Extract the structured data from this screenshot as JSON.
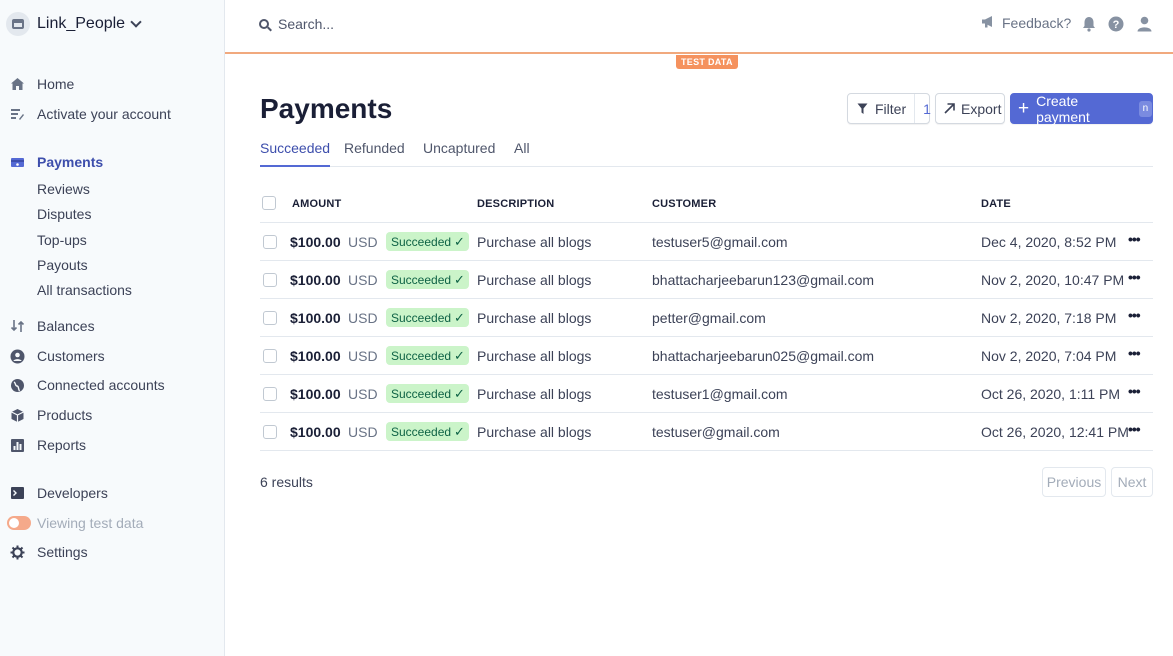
{
  "account": {
    "name": "Link_People"
  },
  "search": {
    "placeholder": "Search..."
  },
  "topbar": {
    "feedback": "Feedback?"
  },
  "test_data_badge": "TEST DATA",
  "nav": {
    "home": "Home",
    "activate": "Activate your account",
    "payments": "Payments",
    "payments_sub": [
      "Reviews",
      "Disputes",
      "Top-ups",
      "Payouts",
      "All transactions"
    ],
    "balances": "Balances",
    "customers": "Customers",
    "connected": "Connected accounts",
    "products": "Products",
    "reports": "Reports",
    "developers": "Developers",
    "viewing_test": "Viewing test data",
    "settings": "Settings"
  },
  "page": {
    "title": "Payments",
    "filter_label": "Filter",
    "filter_count": "1",
    "export_label": "Export",
    "create_label": "Create payment",
    "create_shortcut": "n",
    "tabs": [
      "Succeeded",
      "Refunded",
      "Uncaptured",
      "All"
    ]
  },
  "table": {
    "headers": {
      "amount": "AMOUNT",
      "description": "DESCRIPTION",
      "customer": "CUSTOMER",
      "date": "DATE"
    },
    "rows": [
      {
        "amount": "$100.00",
        "currency": "USD",
        "status": "Succeeded",
        "description": "Purchase all blogs",
        "customer": "testuser5@gmail.com",
        "date": "Dec 4, 2020, 8:52 PM"
      },
      {
        "amount": "$100.00",
        "currency": "USD",
        "status": "Succeeded",
        "description": "Purchase all blogs",
        "customer": "bhattacharjeebarun123@gmail.com",
        "date": "Nov 2, 2020, 10:47 PM"
      },
      {
        "amount": "$100.00",
        "currency": "USD",
        "status": "Succeeded",
        "description": "Purchase all blogs",
        "customer": "petter@gmail.com",
        "date": "Nov 2, 2020, 7:18 PM"
      },
      {
        "amount": "$100.00",
        "currency": "USD",
        "status": "Succeeded",
        "description": "Purchase all blogs",
        "customer": "bhattacharjeebarun025@gmail.com",
        "date": "Nov 2, 2020, 7:04 PM"
      },
      {
        "amount": "$100.00",
        "currency": "USD",
        "status": "Succeeded",
        "description": "Purchase all blogs",
        "customer": "testuser1@gmail.com",
        "date": "Oct 26, 2020, 1:11 PM"
      },
      {
        "amount": "$100.00",
        "currency": "USD",
        "status": "Succeeded",
        "description": "Purchase all blogs",
        "customer": "testuser@gmail.com",
        "date": "Oct 26, 2020, 12:41 PM"
      }
    ]
  },
  "footer": {
    "results": "6 results",
    "previous": "Previous",
    "next": "Next"
  }
}
